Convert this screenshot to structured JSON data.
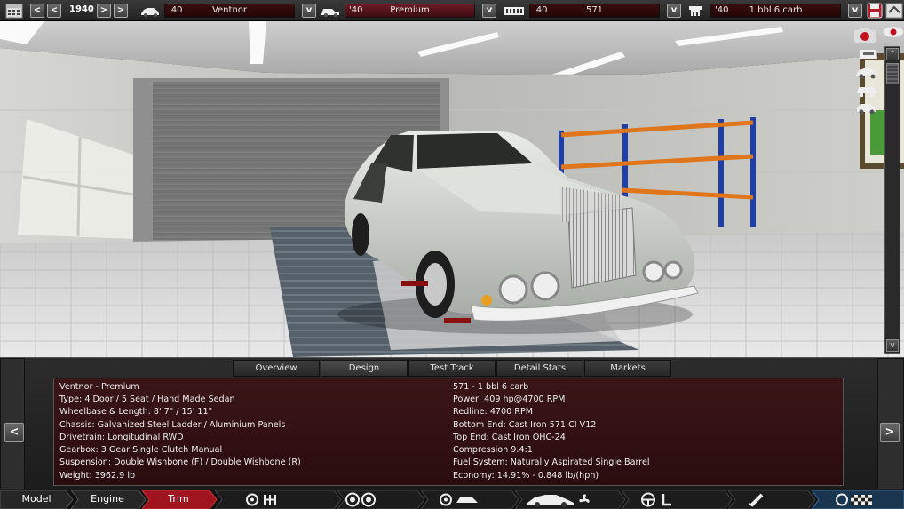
{
  "toolbar": {
    "year": "1940",
    "model": {
      "year": "'40",
      "value": "Ventnor"
    },
    "trim": {
      "year": "'40",
      "value": "Premium"
    },
    "engine": {
      "year": "'40",
      "value": "571"
    },
    "variant": {
      "year": "'40",
      "value": "1 bbl 6 carb"
    },
    "prev_label": "<",
    "prev2_label": "<",
    "next_label": ">",
    "next2_label": ">",
    "dropdown_label": "v"
  },
  "scroll": {
    "up": "^",
    "down": "v"
  },
  "tabs": [
    "Overview",
    "Design",
    "Test Track",
    "Detail Stats",
    "Markets"
  ],
  "active_tab": "Design",
  "info": {
    "left": [
      "Ventnor - Premium",
      "Type: 4 Door / 5 Seat / Hand Made Sedan",
      "Wheelbase & Length: 8' 7\" / 15' 11\"",
      "Chassis: Galvanized Steel Ladder / Aluminium Panels",
      "Drivetrain: Longitudinal RWD",
      "Gearbox: 3 Gear Single Clutch Manual",
      "Suspension: Double Wishbone (F) / Double Wishbone (R)",
      "Weight: 3962.9 lb"
    ],
    "right": [
      "571 - 1 bbl 6 carb",
      "Power: 409 hp@4700 RPM",
      "Redline: 4700 RPM",
      "Bottom End: Cast Iron 571 CI V12",
      "Top End: Cast Iron OHC-24",
      "Compression 9.4:1",
      "Fuel System: Naturally Aspirated Single Barrel",
      "Economy: 14.91% - 0.848 lb/(hph)"
    ]
  },
  "nav": {
    "prev": "<",
    "next": ">"
  },
  "bottom_tabs": [
    "Model",
    "Engine",
    "Trim"
  ],
  "active_bottom_tab": "Trim",
  "bottom_icons": [
    "gearbox-icon",
    "wheels-icon",
    "tire-icon",
    "body-icon",
    "cooling-fan-icon",
    "steering-wheel-icon",
    "seat-icon",
    "exhaust-icon",
    "race-flag-icon"
  ],
  "colors": {
    "accent_red": "#8b1b24",
    "panel_bg": "#2a0c0f",
    "active_tab_bg": "#a0141f"
  }
}
